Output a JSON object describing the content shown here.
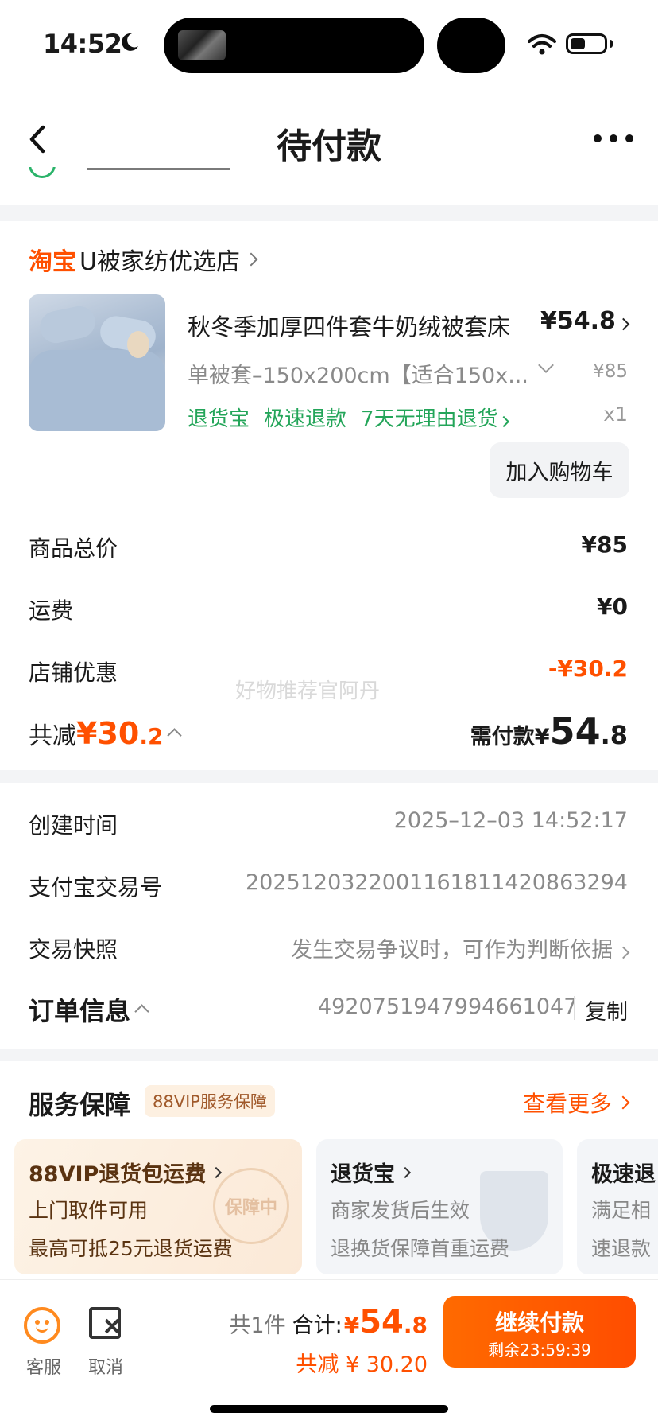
{
  "status_bar": {
    "time": "14:52"
  },
  "nav": {
    "title": "待付款"
  },
  "shop": {
    "platform_label": "淘宝",
    "name": "U被家纺优选店"
  },
  "product": {
    "title": "秋冬季加厚四件套牛奶绒被套床",
    "price": "¥54.8",
    "spec": "单被套–150x200cm【适合150x...",
    "original_price": "¥85",
    "quantity": "x1",
    "tags": [
      "退货宝",
      "极速退款",
      "7天无理由退货"
    ],
    "add_cart_label": "加入购物车"
  },
  "price_summary": {
    "rows": [
      {
        "label": "商品总价",
        "value": "¥85"
      },
      {
        "label": "运费",
        "value": "¥0"
      },
      {
        "label": "店铺优惠",
        "value": "-¥30.2"
      }
    ],
    "watermark": "好物推荐官阿丹",
    "discount_label": "共减",
    "discount_int": "¥30",
    "discount_dec": ".2",
    "payable_label": "需付款¥",
    "payable_int": "54",
    "payable_dec": ".8"
  },
  "order_info": {
    "rows": [
      {
        "label": "创建时间",
        "value": "2025–12–03 14:52:17"
      },
      {
        "label": "支付宝交易号",
        "value": "2025120322001161811420863294"
      },
      {
        "label": "交易快照",
        "value": "发生交易争议时，可作为判断依据"
      }
    ],
    "title": "订单信息",
    "order_number": "4920751947994661047",
    "copy_label": "复制"
  },
  "services": {
    "title": "服务保障",
    "badge": "88VIP服务保障",
    "more_label": "查看更多",
    "cards": [
      {
        "title": "88VIP退货包运费",
        "line1": "上门取件可用",
        "line2": "最高可抵25元退货运费",
        "stamp": "保障中"
      },
      {
        "title": "退货宝",
        "line1": "商家发货后生效",
        "line2": "退换货保障首重运费"
      },
      {
        "title": "极速退",
        "line1": "满足相",
        "line2": "速退款"
      }
    ]
  },
  "bottom_bar": {
    "service_label": "客服",
    "cancel_label": "取消",
    "count_label": "共1件",
    "total_label": "合计:",
    "total_yen": "¥",
    "total_int": "54",
    "total_dec": ".8",
    "discount_text": "共减 ¥ 30.20",
    "pay_label": "继续付款",
    "countdown": "剩余23:59:39"
  },
  "colors": {
    "accent": "#ff5000",
    "success": "#23a559"
  }
}
